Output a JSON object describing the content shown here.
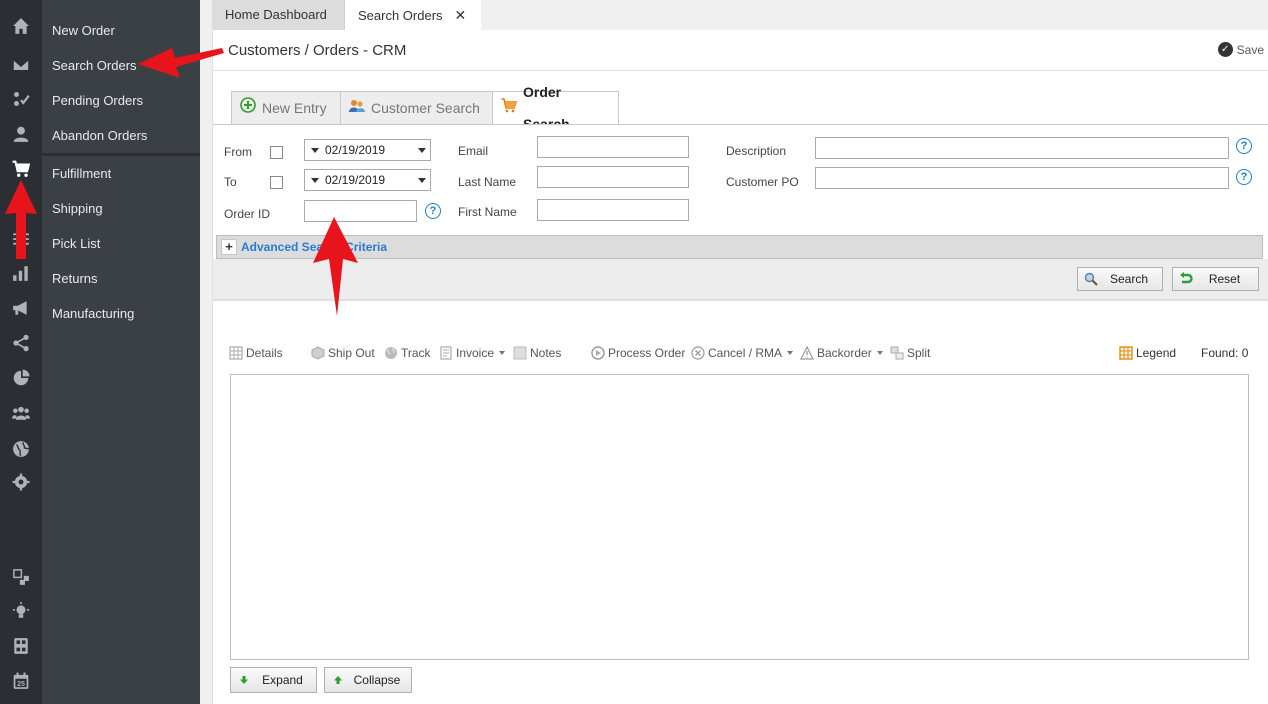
{
  "rail": {
    "icons": [
      "home-icon",
      "mail-icon",
      "tasks-icon",
      "user-icon",
      "cart-icon",
      "sliders-icon",
      "bar-chart-icon",
      "megaphone-icon",
      "share-icon",
      "pie-chart-icon",
      "group-icon",
      "globe-icon",
      "settings-icon",
      "windows-icon",
      "lightbulb-icon",
      "calculator-icon",
      "calendar-icon"
    ],
    "calendar_day": "25"
  },
  "subnav": {
    "items": [
      {
        "label": "New Order"
      },
      {
        "label": "Search Orders"
      },
      {
        "label": "Pending Orders"
      },
      {
        "label": "Abandon Orders"
      },
      {
        "label": "Fulfillment"
      },
      {
        "label": "Shipping"
      },
      {
        "label": "Pick List"
      },
      {
        "label": "Returns"
      },
      {
        "label": "Manufacturing"
      }
    ]
  },
  "tabs": {
    "home": "Home Dashboard",
    "search": "Search Orders",
    "close": "✕"
  },
  "header": {
    "title": "Customers / Orders - CRM",
    "save": "Save"
  },
  "subtabs": {
    "new_entry": "New Entry",
    "customer_search": "Customer Search",
    "order_search": "Order Search"
  },
  "form": {
    "from_label": "From",
    "to_label": "To",
    "order_id_label": "Order ID",
    "from_date": "02/19/2019",
    "to_date": "02/19/2019",
    "email_label": "Email",
    "last_name_label": "Last Name",
    "first_name_label": "First Name",
    "description_label": "Description",
    "customer_po_label": "Customer PO",
    "help": "?"
  },
  "advanced": {
    "plus": "+",
    "label": "Advanced Search Criteria"
  },
  "actions": {
    "search": "Search",
    "reset": "Reset"
  },
  "toolbar": {
    "details": "Details",
    "ship_out": "Ship Out",
    "track": "Track",
    "invoice": "Invoice",
    "notes": "Notes",
    "process_order": "Process Order",
    "cancel_rma": "Cancel / RMA",
    "backorder": "Backorder",
    "split": "Split",
    "legend": "Legend",
    "found": "Found: 0"
  },
  "footer": {
    "expand": "Expand",
    "collapse": "Collapse"
  },
  "colors": {
    "rail": "#2b2f33",
    "subnav": "#3b4045",
    "accent_blue": "#2a7ad2",
    "annotation_red": "#e8141c"
  }
}
